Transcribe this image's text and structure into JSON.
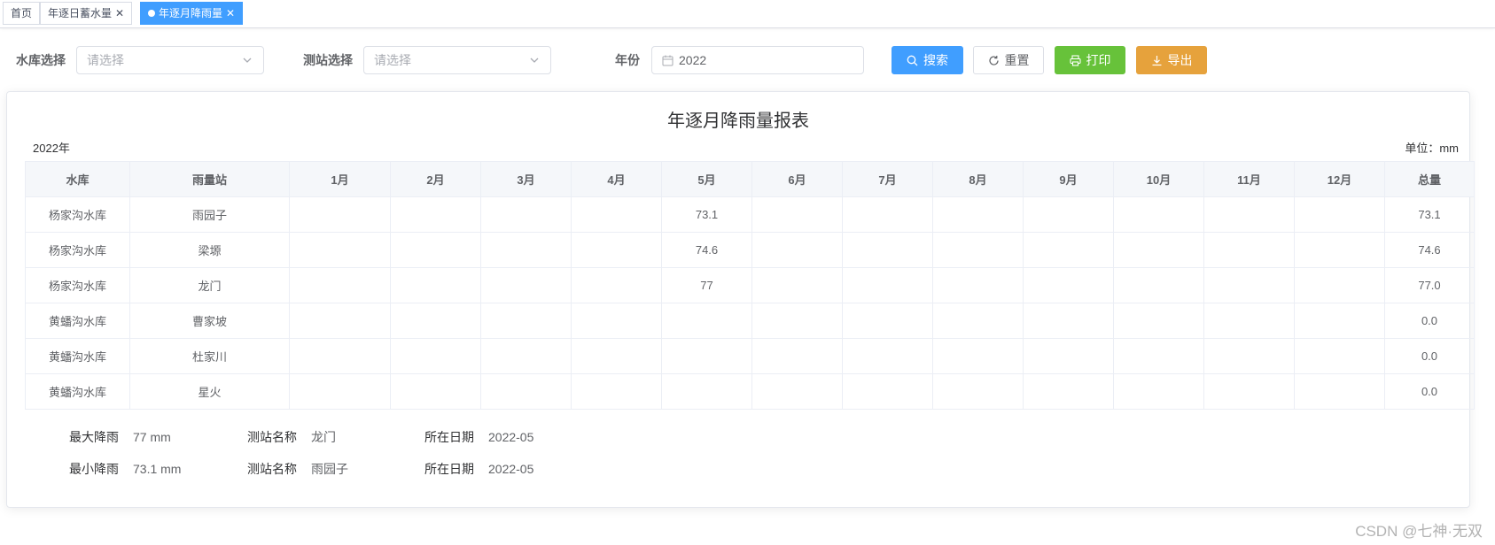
{
  "tabs": [
    {
      "label": "首页",
      "closable": false,
      "active": false
    },
    {
      "label": "年逐日蓄水量",
      "closable": true,
      "active": false
    },
    {
      "label": "年逐月降雨量",
      "closable": true,
      "active": true
    }
  ],
  "search": {
    "reservoir_label": "水库选择",
    "reservoir_placeholder": "请选择",
    "station_label": "测站选择",
    "station_placeholder": "请选择",
    "year_label": "年份",
    "year_value": "2022",
    "buttons": {
      "search": "搜索",
      "reset": "重置",
      "print": "打印",
      "export": "导出"
    }
  },
  "report": {
    "title": "年逐月降雨量报表",
    "year": "2022年",
    "unit": "单位：mm",
    "columns": [
      "水库",
      "雨量站",
      "1月",
      "2月",
      "3月",
      "4月",
      "5月",
      "6月",
      "7月",
      "8月",
      "9月",
      "10月",
      "11月",
      "12月",
      "总量"
    ],
    "rows": [
      [
        "杨家沟水库",
        "雨园子",
        "",
        "",
        "",
        "",
        "73.1",
        "",
        "",
        "",
        "",
        "",
        "",
        "",
        "73.1"
      ],
      [
        "杨家沟水库",
        "梁塬",
        "",
        "",
        "",
        "",
        "74.6",
        "",
        "",
        "",
        "",
        "",
        "",
        "",
        "74.6"
      ],
      [
        "杨家沟水库",
        "龙门",
        "",
        "",
        "",
        "",
        "77",
        "",
        "",
        "",
        "",
        "",
        "",
        "",
        "77.0"
      ],
      [
        "黄蟠沟水库",
        "曹家坡",
        "",
        "",
        "",
        "",
        "",
        "",
        "",
        "",
        "",
        "",
        "",
        "",
        "0.0"
      ],
      [
        "黄蟠沟水库",
        "杜家川",
        "",
        "",
        "",
        "",
        "",
        "",
        "",
        "",
        "",
        "",
        "",
        "",
        "0.0"
      ],
      [
        "黄蟠沟水库",
        "星火",
        "",
        "",
        "",
        "",
        "",
        "",
        "",
        "",
        "",
        "",
        "",
        "",
        "0.0"
      ]
    ]
  },
  "stats": {
    "max": {
      "label": "最大降雨",
      "value": "77 mm",
      "station_label": "测站名称",
      "station": "龙门",
      "date_label": "所在日期",
      "date": "2022-05"
    },
    "min": {
      "label": "最小降雨",
      "value": "73.1 mm",
      "station_label": "测站名称",
      "station": "雨园子",
      "date_label": "所在日期",
      "date": "2022-05"
    }
  },
  "watermark": "CSDN @七神·无双",
  "colors": {
    "primary": "#409eff",
    "success": "#67c23a",
    "warning": "#e6a23c"
  }
}
